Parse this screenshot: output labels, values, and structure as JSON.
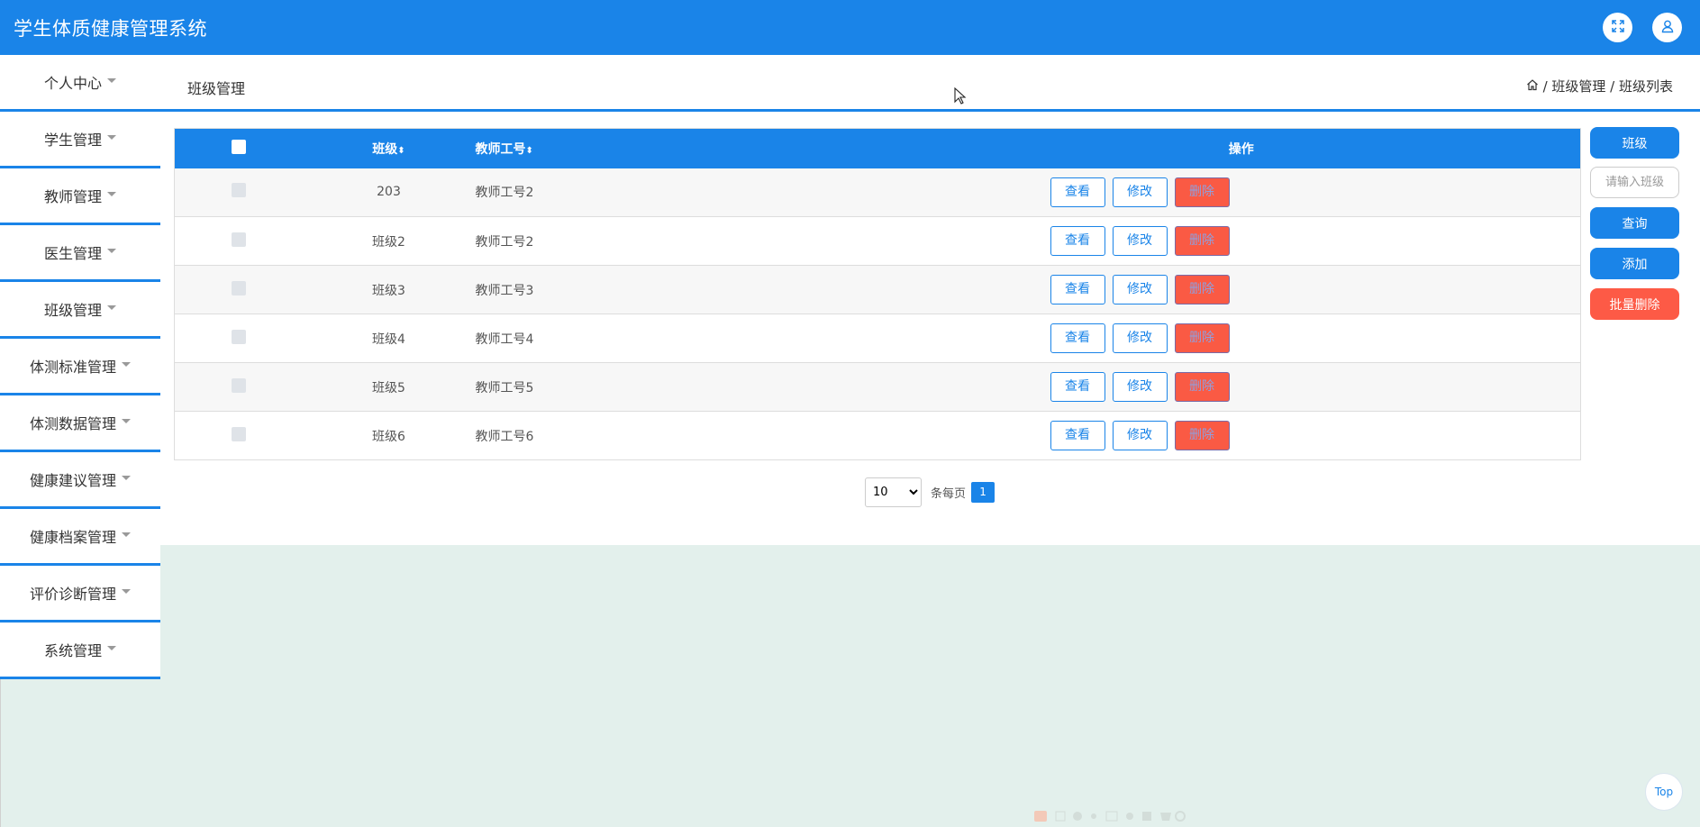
{
  "header": {
    "title": "学生体质健康管理系统",
    "fullscreen_icon": "expand-icon",
    "user_icon": "user-icon"
  },
  "sidebar": {
    "items": [
      {
        "label": "个人中心"
      },
      {
        "label": "学生管理"
      },
      {
        "label": "教师管理"
      },
      {
        "label": "医生管理"
      },
      {
        "label": "班级管理"
      },
      {
        "label": "体测标准管理"
      },
      {
        "label": "体测数据管理"
      },
      {
        "label": "健康建议管理"
      },
      {
        "label": "健康档案管理"
      },
      {
        "label": "评价诊断管理"
      },
      {
        "label": "系统管理"
      }
    ]
  },
  "breadcrumb": {
    "page_title": "班级管理",
    "home_icon": "home-icon",
    "path": "/ 班级管理 / 班级列表"
  },
  "table": {
    "headers": {
      "class": "班级",
      "teacher_id": "教师工号",
      "operations": "操作",
      "sort_glyph": "⬍"
    },
    "rows": [
      {
        "class": "203",
        "teacher_id": "教师工号2"
      },
      {
        "class": "班级2",
        "teacher_id": "教师工号2"
      },
      {
        "class": "班级3",
        "teacher_id": "教师工号3"
      },
      {
        "class": "班级4",
        "teacher_id": "教师工号4"
      },
      {
        "class": "班级5",
        "teacher_id": "教师工号5"
      },
      {
        "class": "班级6",
        "teacher_id": "教师工号6"
      }
    ],
    "actions": {
      "view": "查看",
      "edit": "修改",
      "delete": "删除"
    }
  },
  "pagination": {
    "page_size": "10",
    "page_size_options": [
      "10"
    ],
    "per_page_label": "条每页",
    "current_page": "1"
  },
  "right_actions": {
    "class_label": "班级",
    "class_input_placeholder": "请输入班级",
    "query": "查询",
    "add": "添加",
    "batch_delete": "批量删除"
  },
  "top_button": "Top",
  "colors": {
    "primary": "#1a84e8",
    "danger": "#fd5a46",
    "page_background": "#e3f0ec"
  }
}
